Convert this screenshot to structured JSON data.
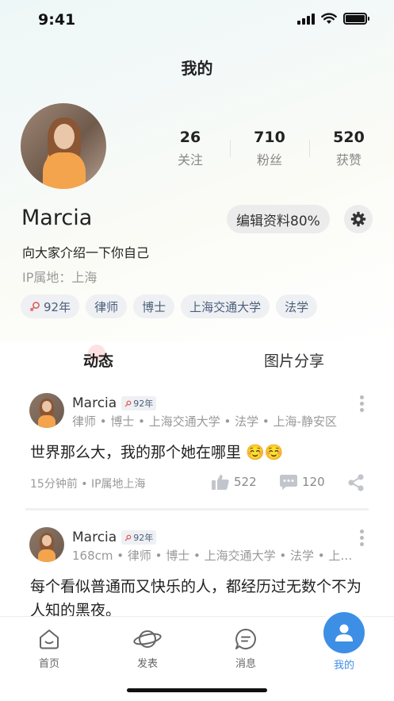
{
  "status_bar": {
    "time": "9:41"
  },
  "header": {
    "title": "我的"
  },
  "profile": {
    "username": "Marcia",
    "edit_label": "编辑资料80%",
    "bio": "向大家介绍一下你自己",
    "ip": "IP属地：上海",
    "stats": [
      {
        "value": "26",
        "label": "关注"
      },
      {
        "value": "710",
        "label": "粉丝"
      },
      {
        "value": "520",
        "label": "获赞"
      }
    ],
    "tags": [
      "92年",
      "律师",
      "博士",
      "上海交通大学",
      "法学"
    ]
  },
  "tabs": [
    "动态",
    "图片分享"
  ],
  "posts": [
    {
      "name": "Marcia",
      "age_badge": "92年",
      "meta": "律师 • 博士 • 上海交通大学 • 法学 • 上海-静安区",
      "content": "世界那么大，我的那个她在哪里 ☺️☺️",
      "time": "15分钟前 • IP属地上海",
      "likes": "522",
      "comments": "120"
    },
    {
      "name": "Marcia",
      "age_badge": "92年",
      "meta": "168cm • 律师 • 博士 • 上海交通大学 • 法学 • 上…",
      "content": "每个看似普通而又快乐的人，都经历过无数个不为人知的黑夜。"
    }
  ],
  "tabbar": {
    "items": [
      {
        "label": "首页",
        "icon": "home-icon"
      },
      {
        "label": "发表",
        "icon": "planet-icon"
      },
      {
        "label": "消息",
        "icon": "message-icon"
      },
      {
        "label": "我的",
        "icon": "user-icon"
      }
    ],
    "accent": "#3d8fe5"
  }
}
